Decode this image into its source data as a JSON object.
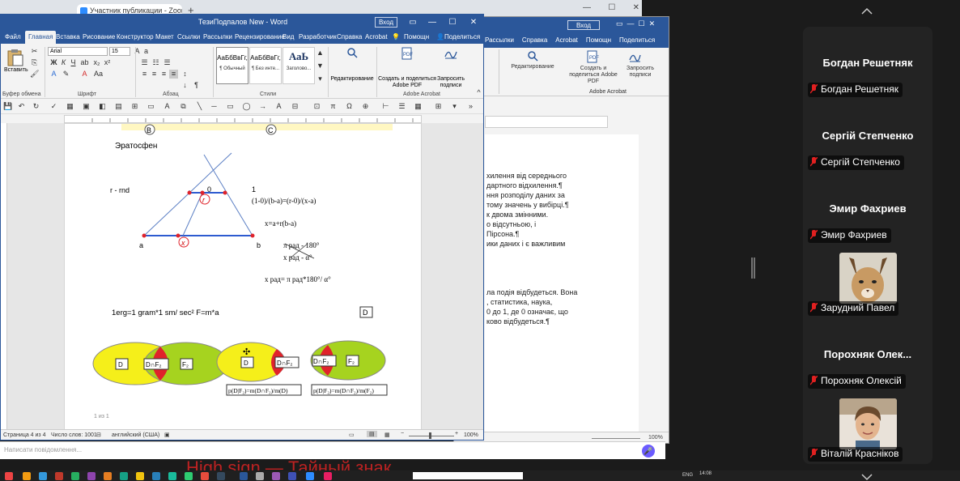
{
  "browser": {
    "tab_title": "Участник публикации - Zoom",
    "plus": "+",
    "controls": [
      "—",
      "☐",
      "✕"
    ]
  },
  "word": {
    "title": "ТезиПодпалов New  -  Word",
    "sign_in": "Вход",
    "menu": [
      "Файл",
      "Главная",
      "Вставка",
      "Рисование",
      "Конструктор",
      "Макет",
      "Ссылки",
      "Рассылки",
      "Рецензирование",
      "Вид",
      "Разработчик",
      "Справка",
      "Acrobat",
      "Помощн",
      "Поделиться"
    ],
    "ribbon": {
      "paste": "Вставить",
      "font_name": "Arial",
      "font_size": "15",
      "styles": [
        {
          "sample": "АаБбВвГг,",
          "name": "¶ Обычный"
        },
        {
          "sample": "АаБбВвГг,",
          "name": "¶ Без инте..."
        },
        {
          "sample": "АаЬ",
          "name": "Заголово..."
        }
      ],
      "editing": "Редактирование",
      "create_share": "Создать и поделиться Adobe PDF",
      "request_sign": "Запросить подписи",
      "groups": [
        "Буфер обмена",
        "Шрифт",
        "Абзац",
        "Стили",
        "Adobe Acrobat"
      ]
    },
    "doc": {
      "header_b": "B",
      "header_c": "C",
      "title": "Эратосфен",
      "r_rnd": "r - rnd",
      "zero": "0",
      "r_label": "r",
      "one": "1",
      "eq1": "(1-0)/(b-a)=(r-0)/(x-a)",
      "eq2": "x=a+r(b-a)",
      "a_label": "a",
      "x_label": "x",
      "b_label": "b",
      "eq3": "π рад - 180°",
      "eq4": "x рад - α°",
      "eq5": "x рад= π рад*180°/ α°",
      "erg": "1erg=1 gram*1 sm/ sec²   F=m*a",
      "box_d": "D",
      "v1": [
        "D",
        "D∩F₂",
        "F₂"
      ],
      "v2": [
        "D",
        "D∩F₂"
      ],
      "v3": [
        "D∩F₂",
        "F₂"
      ],
      "f1": "p(D|F₂)=m(D∩F₂)/m(D)",
      "f2": "p(D|F₂)=m(D∩F₂)/m(F₂)",
      "footer": "1 из 1"
    },
    "status": {
      "page": "Страница 4 из 4",
      "words": "Число слов: 1001",
      "lang": "английский (США)",
      "zoom": "100%"
    }
  },
  "bg_word": {
    "sign_in": "Вход",
    "menu": [
      "Рассылки",
      "Справка",
      "Acrobat",
      "Помощн",
      "Поделиться"
    ],
    "editing": "Редактирование",
    "create_share": "Создать и поделиться Adobe PDF",
    "request_sign": "Запросить подписи",
    "group": "Adobe Acrobat",
    "lines": [
      "хилення від середнього",
      "дартного відхилення.¶",
      "ння розподілу даних за",
      "тому значень у вибірці.¶",
      "к двома змінними.",
      "о відсутньою, і",
      " Пірсона.¶",
      "",
      "ики даних і є важливим",
      "",
      "",
      "",
      "",
      "ла подія відбудеться. Вона",
      ", статистика, наука,",
      "0 до 1, де 0 означає, що",
      "ково відбудеться.¶"
    ],
    "zoom": "100%"
  },
  "zoom": {
    "chat_placeholder": "Написати повідомлення...",
    "slide_text": "High sign — Тайный знак",
    "participants": [
      {
        "big_name": "Богдан Решетняк",
        "label": "Богдан Решетняк"
      },
      {
        "big_name": "Сергій Степченко",
        "label": "Сергій Степченко"
      },
      {
        "big_name": "Эмир Фахриев",
        "label": "Эмир Фахриев"
      },
      {
        "big_name": "",
        "label": "Зарудний Павел",
        "avatar": "caracal-photo"
      },
      {
        "big_name": "Порохняк  Олек...",
        "label": "Порохняк Олексій"
      },
      {
        "big_name": "",
        "label": "Віталій Красніков",
        "avatar": "person-photo"
      }
    ]
  },
  "taskbar": {
    "clock": "14:08",
    "lang": "ENG"
  },
  "colors": {
    "word_blue": "#2b579a",
    "zoom_panel": "#232323",
    "venn_yellow": "#f5ef1a",
    "venn_green": "#a6d31f",
    "venn_red": "#e0232b"
  }
}
